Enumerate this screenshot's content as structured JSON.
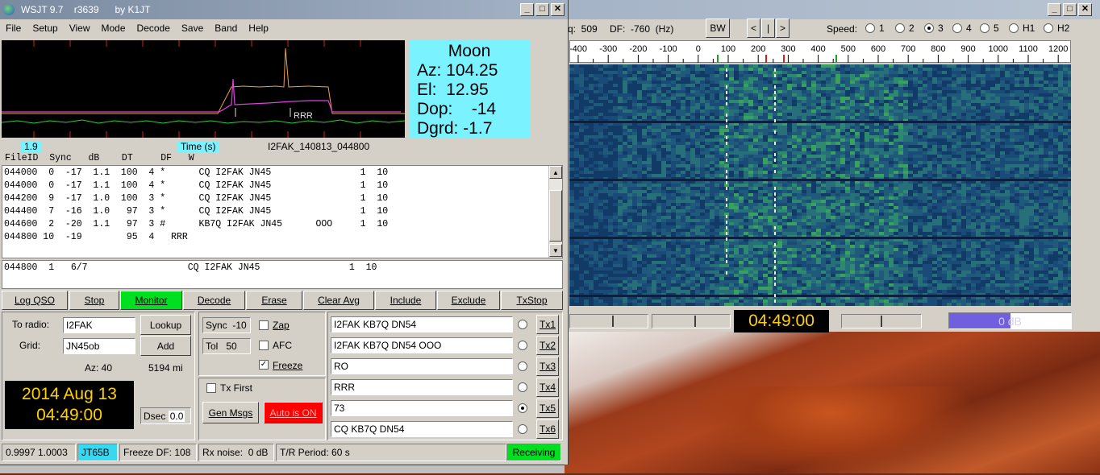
{
  "left_window": {
    "title": "WSJT 9.7    r3639      by K1JT",
    "menu": [
      "File",
      "Setup",
      "View",
      "Mode",
      "Decode",
      "Save",
      "Band",
      "Help"
    ],
    "moon": {
      "label": "Moon",
      "az": "Az: 104.25",
      "el": "El:  12.95",
      "dop": "Dop:    -14",
      "dgrd": "Dgrd: -1.7"
    },
    "plot": {
      "left_value": "1.9",
      "time_label": "Time (s)",
      "filename": "I2FAK_140813_044800",
      "rrr_label": "RRR"
    },
    "decode_header": "FileID  Sync   dB    DT     DF   W",
    "decode_rows": [
      "044000  0  -17  1.1  100  4 *      CQ I2FAK JN45                1  10",
      "044000  0  -17  1.1  100  4 *      CQ I2FAK JN45                1  10",
      "044200  9  -17  1.0  100  3 *      CQ I2FAK JN45                1  10",
      "044400  7  -16  1.0   97  3 *      CQ I2FAK JN45                1  10",
      "044600  2  -20  1.1   97  3 #      KB7Q I2FAK JN45      OOO     1  10",
      "044800 10  -19        95  4   RRR"
    ],
    "avg_row": "044800  1   6/7                  CQ I2FAK JN45                1  10",
    "buttons": [
      "Log QSO",
      "Stop",
      "Monitor",
      "Decode",
      "Erase",
      "Clear Avg",
      "Include",
      "Exclude",
      "TxStop"
    ],
    "to_radio_label": "To radio:",
    "to_radio": "I2FAK",
    "lookup": "Lookup",
    "grid_label": "Grid:",
    "grid": "JN45ob",
    "add": "Add",
    "az": "Az: 40",
    "dist": "5194 mi",
    "date": "2014 Aug 13",
    "time": "04:49:00",
    "dsec_label": "Dsec",
    "dsec": "0.0",
    "sync_label": "Sync",
    "sync": "-10",
    "tol_label": "Tol",
    "tol": "50",
    "zap": "Zap",
    "afc": "AFC",
    "freeze": "Freeze",
    "txfirst": "Tx First",
    "genmsgs": "Gen Msgs",
    "auto": "Auto is ON",
    "tx_msgs": [
      "I2FAK KB7Q DN54",
      "I2FAK KB7Q DN54 OOO",
      "RO",
      "RRR",
      "73",
      "CQ KB7Q DN54"
    ],
    "tx_labels": [
      "Tx1",
      "Tx2",
      "Tx3",
      "Tx4",
      "Tx5",
      "Tx6"
    ],
    "tx_selected": 4,
    "status": {
      "ratio": "0.9997 1.0003",
      "mode": "JT65B",
      "freeze_df": "Freeze DF: 108",
      "rx_noise": "Rx noise:  0 dB",
      "tr": "T/R Period: 60 s",
      "state": "Receiving"
    },
    "colors": {
      "monitor": "#00e020",
      "auto": "#ff0000",
      "moon_bg": "#7af2ff",
      "receiving": "#00e020"
    }
  },
  "right_window": {
    "freq_label": "q:  509",
    "df_label": "DF:  -760  (Hz)",
    "bw": "BW",
    "nav": [
      "<",
      "|",
      ">"
    ],
    "speed_label": "Speed:",
    "speeds": [
      "1",
      "2",
      "3",
      "4",
      "5",
      "H1",
      "H2"
    ],
    "speed_selected": 2,
    "scale": [
      "-400",
      "-300",
      "-200",
      "-100",
      "0",
      "100",
      "200",
      "300",
      "400",
      "500",
      "600",
      "700",
      "800",
      "900",
      "1000",
      "1100",
      "1200"
    ],
    "clock": "04:49:00",
    "level": "0 dB"
  }
}
